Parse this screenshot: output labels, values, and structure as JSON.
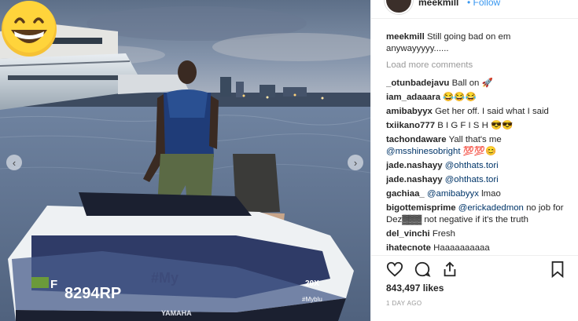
{
  "header": {
    "username": "meekmill",
    "follow_label": "Follow"
  },
  "photo": {
    "jetski_reg": "8294RP",
    "jetski_state": "F",
    "jetski_hull_text": "#My",
    "jetski_model": "20X",
    "jetski_small_text": "#Myblu",
    "jetski_brand": "YAMAHA",
    "emoji_icon": "grinning-face-icon"
  },
  "caption": {
    "user": "meekmill",
    "text": "Still going bad on em anywayyyyy......"
  },
  "load_more_label": "Load more comments",
  "comments": [
    {
      "user": "_otunbadejavu",
      "text": "Ball on 🚀"
    },
    {
      "user": "iam_adaaara",
      "text": "😂😂😂"
    },
    {
      "user": "amibabyyx",
      "text": "Get her off. I said what I said"
    },
    {
      "user": "txiikano777",
      "text": "B I G F I S H 😎😎"
    },
    {
      "user": "tachondaware",
      "text": "Yall that's me",
      "mention": "@msshinesobright",
      "extra": " 💯💯😊"
    },
    {
      "user": "jade.nashayy",
      "text": "",
      "mention": "@ohthats.tori"
    },
    {
      "user": "jade.nashayy",
      "text": "",
      "mention": "@ohthats.tori"
    },
    {
      "user": "gachiaa_",
      "text": " lmao",
      "mention": "@amibabyyx"
    },
    {
      "user": "bigottemisprime",
      "text": " no job for Dez▓▓▓ not negative if it's the truth",
      "mention": "@erickadedmon"
    },
    {
      "user": "del_vinchi",
      "text": "Fresh"
    },
    {
      "user": "ihatecnote",
      "text": "Haaaaaaaaaa"
    }
  ],
  "actions": {
    "likes_text": "843,497 likes",
    "date_text": "1 DAY AGO",
    "icons": [
      "heart-icon",
      "comment-icon",
      "share-icon",
      "bookmark-icon"
    ]
  },
  "colors": {
    "link": "#003569",
    "follow": "#3897f0",
    "muted": "#999999"
  }
}
